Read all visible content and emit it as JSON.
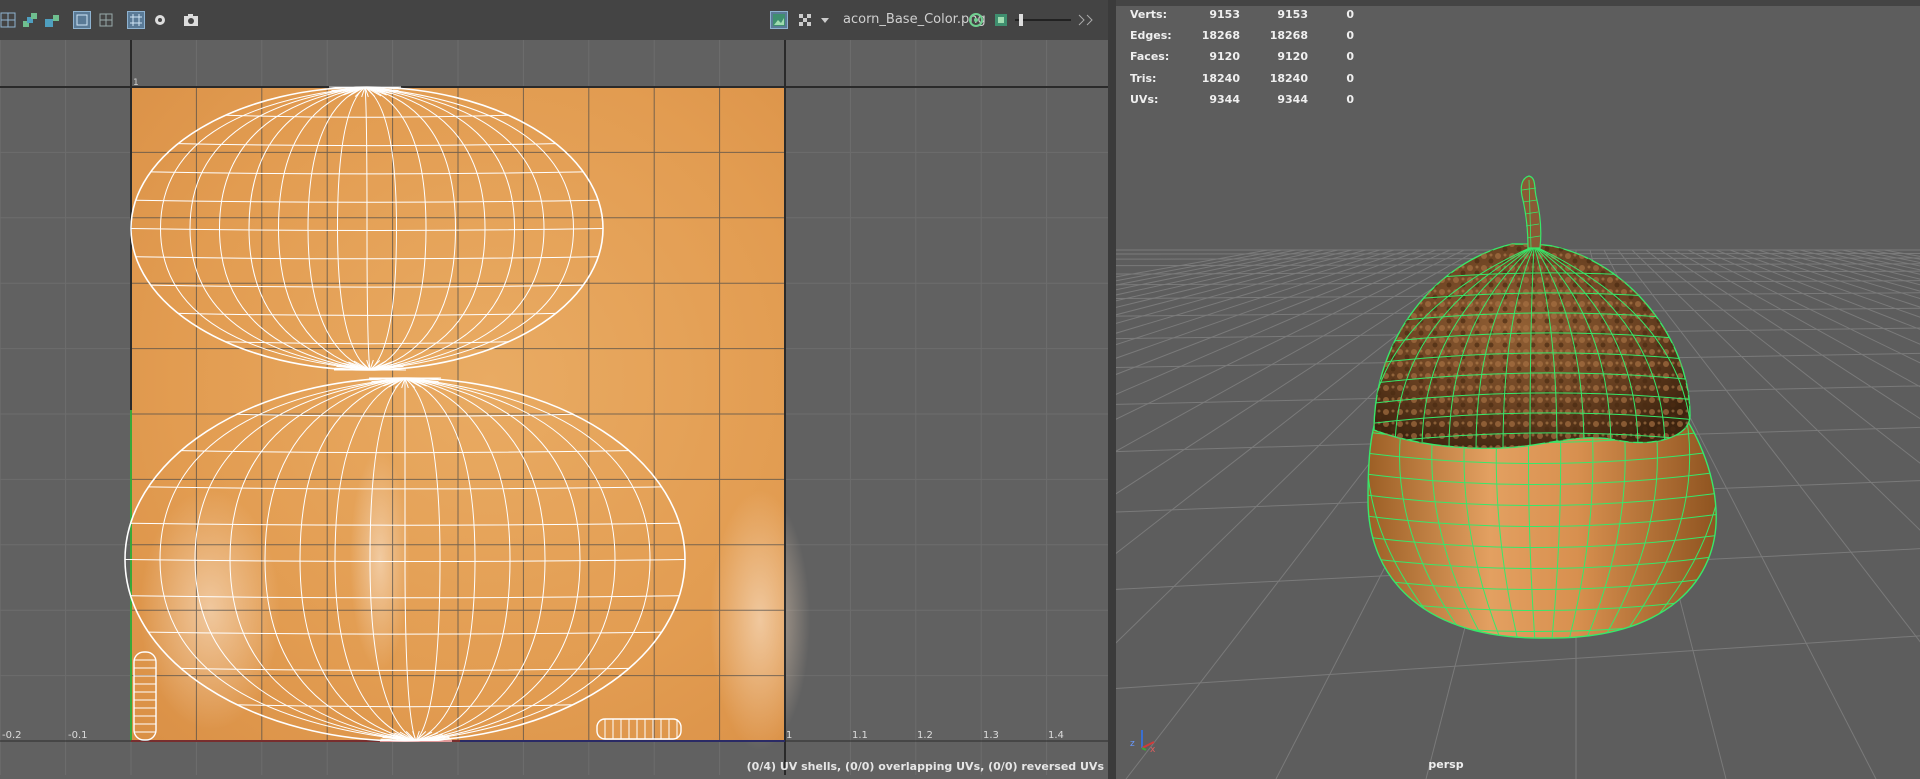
{
  "uv_editor": {
    "texture_name": "acorn_Base_Color.png",
    "status": "(0/4) UV shells, (0/0) overlapping UVs, (0/0) reversed UVs",
    "axis_labels": [
      "-0.2",
      "-0.1",
      "1",
      "1.1",
      "1.2",
      "1.3",
      "1.4"
    ],
    "axis_top_label": "1"
  },
  "viewport": {
    "camera": "persp",
    "hud": {
      "rows": [
        {
          "label": "Verts:",
          "v1": "9153",
          "v2": "9153",
          "v3": "0"
        },
        {
          "label": "Edges:",
          "v1": "18268",
          "v2": "18268",
          "v3": "0"
        },
        {
          "label": "Faces:",
          "v1": "9120",
          "v2": "9120",
          "v3": "0"
        },
        {
          "label": "Tris:",
          "v1": "18240",
          "v2": "18240",
          "v3": "0"
        },
        {
          "label": "UVs:",
          "v1": "9344",
          "v2": "9344",
          "v3": "0"
        }
      ]
    },
    "axis_labels": {
      "z": "z",
      "x": "x"
    }
  },
  "colors": {
    "texture": "#e5a45c",
    "wireframe": "#ffffff",
    "selection_green": "#37e86a",
    "cap": "#6b4222"
  }
}
